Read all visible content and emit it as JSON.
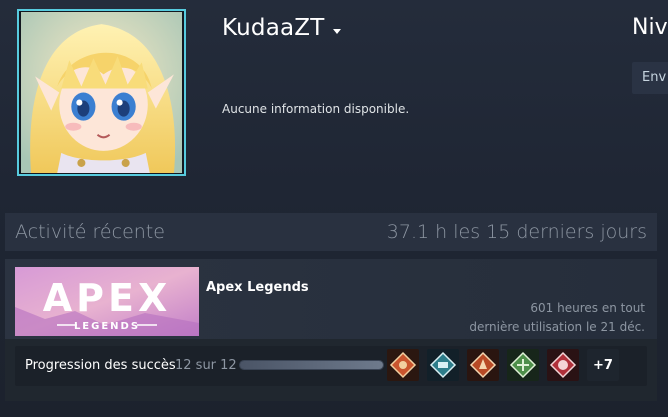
{
  "profile": {
    "username": "KudaaZT",
    "summary": "Aucune information disponible.",
    "level_label": "Niv",
    "send_button_label": "Env"
  },
  "recent_activity": {
    "title": "Activité récente",
    "hours_summary": "37.1 h les 15 derniers jours"
  },
  "game": {
    "name": "Apex Legends",
    "capsule_title": "APEX",
    "capsule_subtitle": "LEGENDS",
    "hours_total": "601 heures en tout",
    "last_played": "dernière utilisation le 21 déc.",
    "achievements": {
      "label": "Progression des succès",
      "count": "12 sur 12",
      "progress": 1.0,
      "icons": [
        "achievement-icon",
        "achievement-icon",
        "achievement-icon",
        "achievement-icon",
        "achievement-icon"
      ],
      "more_label": "+7"
    }
  },
  "colors": {
    "accent": "#57cbde",
    "background": "#1e2430"
  }
}
